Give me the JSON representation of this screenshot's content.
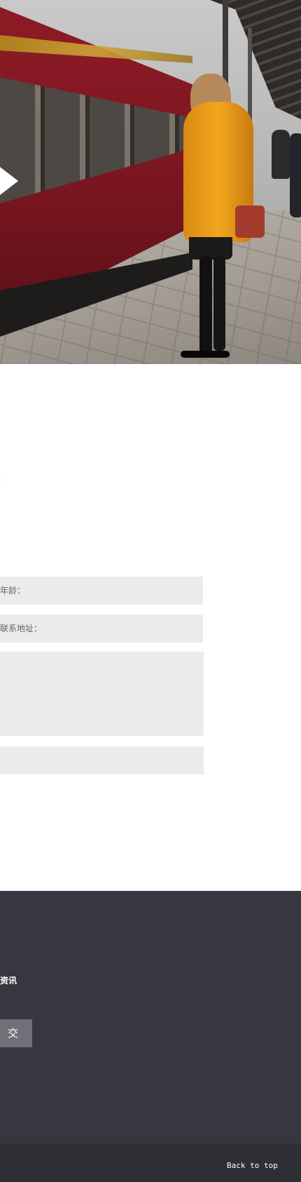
{
  "form": {
    "marker": "：",
    "age_label": "年龄：",
    "address_label": "联系地址："
  },
  "footer": {
    "news_label": "资讯",
    "submit_label": "交",
    "back_to_top": "Back to top"
  },
  "colors": {
    "field_background": "#ebebeb",
    "footer_background": "#373740",
    "bottom_bar_background": "#2e2e35",
    "submit_button_background": "#707078"
  },
  "icons": {
    "slider_prev": "triangle-arrow-icon"
  }
}
